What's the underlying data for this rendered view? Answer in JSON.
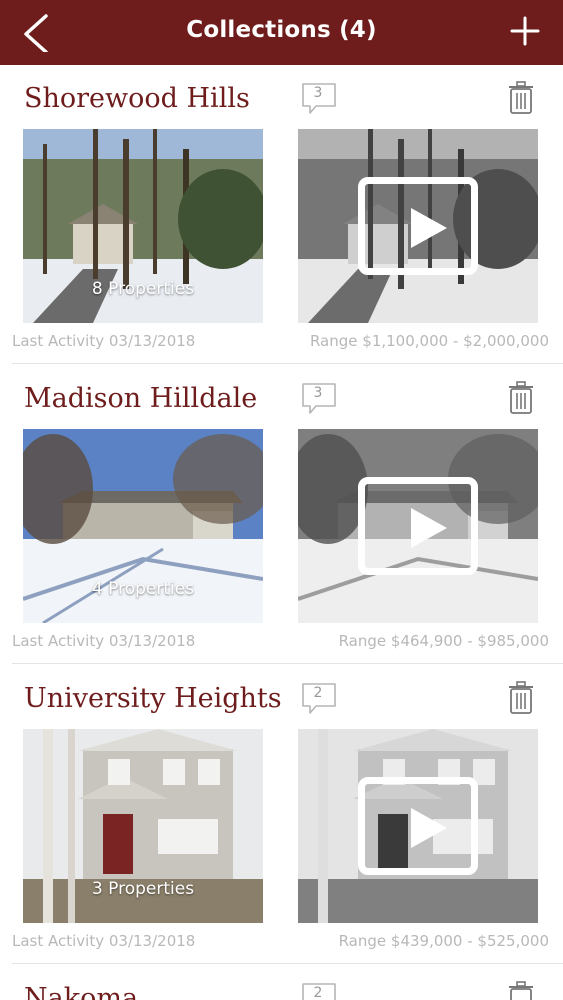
{
  "nav": {
    "title": "Collections (4)",
    "back_icon": "chevron-left-icon",
    "add_icon": "plus-icon",
    "bar_color": "#6e1c1c"
  },
  "collections": [
    {
      "name": "Shorewood Hills",
      "comments": "3",
      "properties_label": "8 Properties",
      "last_activity": "Last Activity 03/13/2018",
      "range": "Range $1,100,000 - $2,000,000"
    },
    {
      "name": "Madison Hilldale",
      "comments": "3",
      "properties_label": "4 Properties",
      "last_activity": "Last Activity 03/13/2018",
      "range": "Range $464,900 - $985,000"
    },
    {
      "name": "University Heights",
      "comments": "2",
      "properties_label": "3 Properties",
      "last_activity": "Last Activity 03/13/2018",
      "range": "Range $439,000 - $525,000"
    },
    {
      "name": "Nakoma",
      "comments": "2"
    }
  ]
}
